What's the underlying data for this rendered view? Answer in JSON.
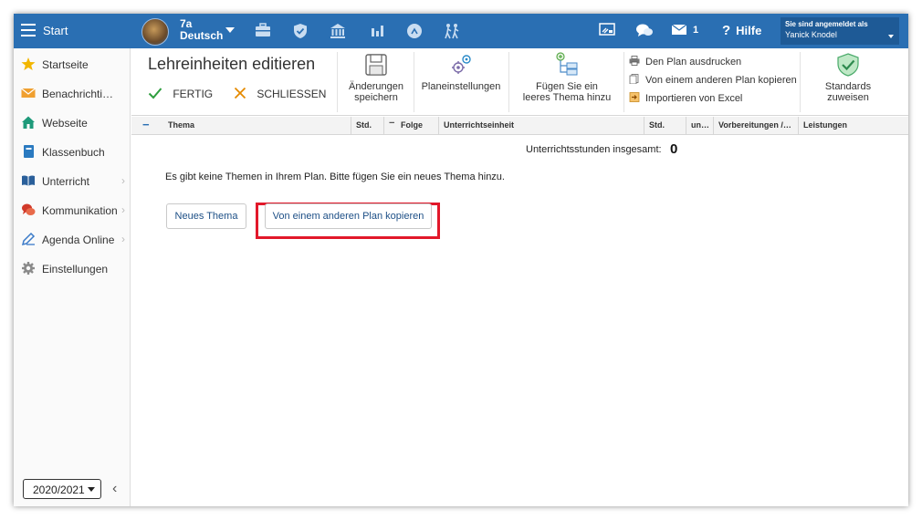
{
  "topbar": {
    "start_label": "Start",
    "class_name": "7a",
    "subject": "Deutsch",
    "message_count": "1",
    "help_label": "Hilfe",
    "signed_in_label": "Sie sind angemeldet als",
    "user_name": "Yanick Knodel",
    "icons": [
      "briefcase-icon",
      "shield-icon",
      "bank-icon",
      "bar-chart-icon",
      "plugin-icon",
      "people-walk-icon",
      "cast-icon",
      "chat-icon",
      "mail-icon"
    ]
  },
  "sidebar": {
    "items": [
      {
        "label": "Startseite",
        "icon": "star-icon",
        "has_chevron": false
      },
      {
        "label": "Benachrichtigungen",
        "icon": "envelope-icon",
        "has_chevron": false
      },
      {
        "label": "Webseite",
        "icon": "home-icon",
        "has_chevron": false
      },
      {
        "label": "Klassenbuch",
        "icon": "book-icon",
        "has_chevron": false
      },
      {
        "label": "Unterricht",
        "icon": "open-book-icon",
        "has_chevron": true
      },
      {
        "label": "Kommunikation",
        "icon": "chat-icon",
        "has_chevron": true
      },
      {
        "label": "Agenda Online",
        "icon": "pen-icon",
        "has_chevron": true
      },
      {
        "label": "Einstellungen",
        "icon": "gear-icon",
        "has_chevron": false
      }
    ],
    "school_year": "2020/2021"
  },
  "ribbon": {
    "title": "Lehreinheiten editieren",
    "done_label": "FERTIG",
    "close_label": "SCHLIESSEN",
    "save_line1": "Änderungen",
    "save_line2": "speichern",
    "plan_settings": "Planeinstellungen",
    "add_line1": "Fügen Sie ein",
    "add_line2": "leeres Thema hinzu",
    "print_plan": "Den Plan ausdrucken",
    "copy_plan": "Von einem anderen Plan kopieren",
    "import_excel": "Importieren von Excel",
    "standards_line1": "Standards",
    "standards_line2": "zuweisen",
    "colors": {
      "accent": "#2a6fb3",
      "done": "#2e9e3e",
      "close": "#e58a00"
    }
  },
  "table": {
    "headers": [
      "Thema",
      "Std.",
      "Folge",
      "Unterrichtseinheit",
      "Std.",
      "un…",
      "Vorbereitungen /…",
      "Leistungen"
    ]
  },
  "content": {
    "total_label": "Unterrichtsstunden insgesamt:",
    "total_value": "0",
    "empty_message": "Es gibt keine Themen in Ihrem Plan. Bitte fügen Sie ein neues Thema hinzu.",
    "new_topic_button": "Neues Thema",
    "copy_button": "Von einem anderen Plan kopieren",
    "highlight_color": "#e2182a"
  }
}
